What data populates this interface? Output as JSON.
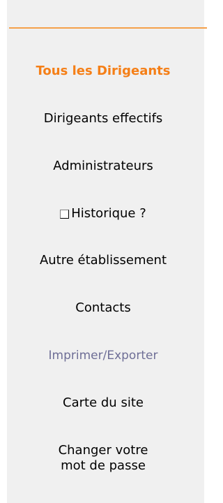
{
  "nav": {
    "all_directors": "Tous les Dirigeants",
    "effective_directors": "Dirigeants effectifs",
    "administrators": "Administrateurs",
    "history_label": "Historique ?",
    "history_checked": false,
    "other_establishment": "Autre établissement",
    "contacts": "Contacts",
    "print_export": "Imprimer/Exporter",
    "site_map": "Carte du site",
    "change_password_line1": "Changer votre",
    "change_password_line2": "mot de passe"
  },
  "colors": {
    "active": "#f57f17",
    "rule": "#f5a04a",
    "muted": "#6e6e96",
    "panel": "#f0f0f0"
  }
}
